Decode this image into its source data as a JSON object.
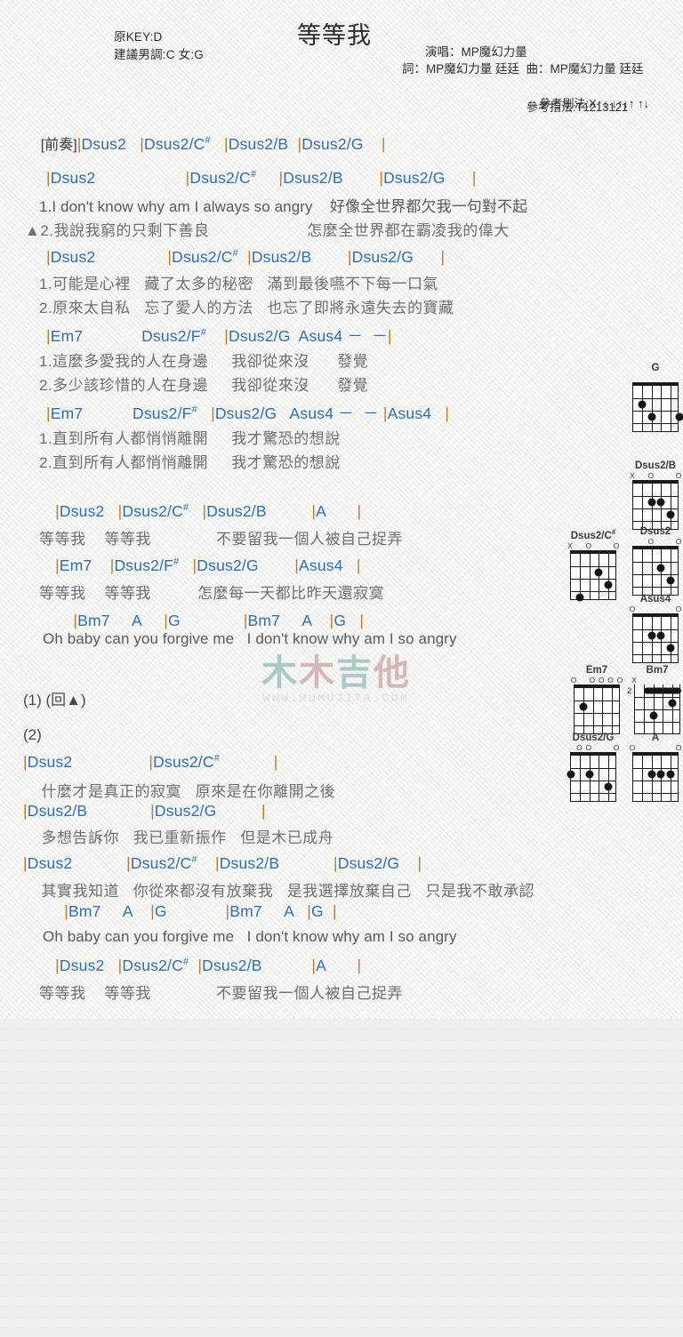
{
  "header": {
    "title": "等等我",
    "orig_key": "原KEY:D",
    "suggested_key": "建議男調:C 女:G",
    "singer": "演唱：MP魔幻力量",
    "writers": "詞：MP魔幻力量 廷廷  曲：MP魔幻力量 廷廷",
    "strum_label": "參考刷法:X",
    "strum_pattern": "↑↓ ↓↑↓↑ ↑↓",
    "fingering": "參考指法:T1213121"
  },
  "watermark": {
    "logo_chars": [
      "木",
      "木",
      "吉",
      "他"
    ],
    "url": "WWW.MUMUJITA.COM"
  },
  "sections": [
    {
      "name": "intro",
      "label": "[前奏]",
      "chords": "|Dsus2   |Dsus2/C#   |Dsus2/B  |Dsus2/G    |"
    }
  ],
  "lines": [
    {
      "type": "chord",
      "id": "c1",
      "text": "|Dsus2                    |Dsus2/C#     |Dsus2/B        |Dsus2/G      |"
    },
    {
      "type": "lyric",
      "id": "l1a",
      "text": "1.I don't know why am I always so angry    好像全世界都欠我一句對不起"
    },
    {
      "type": "lyric",
      "id": "l1b",
      "text": "▲2.我說我窮的只剩下善良                     怎麼全世界都在霸凌我的偉大"
    },
    {
      "type": "chord",
      "id": "c2",
      "text": "|Dsus2                |Dsus2/C#  |Dsus2/B        |Dsus2/G      |"
    },
    {
      "type": "lyric",
      "id": "l2a",
      "text": "1.可能是心裡   藏了太多的秘密   滿到最後嚥不下每一口氣"
    },
    {
      "type": "lyric",
      "id": "l2b",
      "text": "2.原來太自私   忘了愛人的方法   也忘了即將永遠失去的寶藏"
    },
    {
      "type": "chord",
      "id": "c3",
      "text": "|Em7             Dsus2/F#    |Dsus2/G  Asus4 －  －|"
    },
    {
      "type": "lyric",
      "id": "l3a",
      "text": "1.這麼多愛我的人在身邊     我卻從來沒      發覺"
    },
    {
      "type": "lyric",
      "id": "l3b",
      "text": "2.多少該珍惜的人在身邊     我卻從來沒      發覺"
    },
    {
      "type": "chord",
      "id": "c4",
      "text": "|Em7           Dsus2/F#   |Dsus2/G   Asus4 －  － |Asus4   |"
    },
    {
      "type": "lyric",
      "id": "l4a",
      "text": "1.直到所有人都悄悄離開     我才驚恐的想說"
    },
    {
      "type": "lyric",
      "id": "l4b",
      "text": "2.直到所有人都悄悄離開     我才驚恐的想說"
    },
    {
      "type": "chord",
      "id": "c5",
      "text": "  |Dsus2   |Dsus2/C#   |Dsus2/B          |A       |"
    },
    {
      "type": "lyric",
      "id": "l5",
      "text": "等等我    等等我              不要留我一個人被自己捉弄"
    },
    {
      "type": "chord",
      "id": "c6",
      "text": "  |Em7    |Dsus2/F#   |Dsus2/G        |Asus4   |"
    },
    {
      "type": "lyric",
      "id": "l6",
      "text": "等等我    等等我          怎麼每一天都比昨天還寂寞"
    },
    {
      "type": "chord",
      "id": "c7",
      "text": "      |Bm7     A     |G              |Bm7     A    |G   |"
    },
    {
      "type": "lyric_en",
      "id": "l7",
      "text": "Oh baby can you forgive me   I don't know why am I so angry"
    },
    {
      "type": "section",
      "id": "s1",
      "text": "(1) (回▲)"
    },
    {
      "type": "section",
      "id": "s2",
      "text": "(2)"
    },
    {
      "type": "chord",
      "id": "c8",
      "text": "|Dsus2                 |Dsus2/C#            |"
    },
    {
      "type": "lyric",
      "id": "l8",
      "text": "  什麼才是真正的寂寞   原來是在你離開之後"
    },
    {
      "type": "chord",
      "id": "c9",
      "text": "|Dsus2/B              |Dsus2/G          |"
    },
    {
      "type": "lyric",
      "id": "l9",
      "text": "  多想告訴你   我已重新振作   但是木已成舟"
    },
    {
      "type": "chord",
      "id": "c10",
      "text": "|Dsus2            |Dsus2/C#    |Dsus2/B            |Dsus2/G    |"
    },
    {
      "type": "lyric",
      "id": "l10",
      "text": "  其實我知道   你從來都沒有放棄我   是我選擇放棄自己   只是我不敢承認"
    },
    {
      "type": "chord",
      "id": "c11",
      "text": "    |Bm7     A    |G             |Bm7     A   |G  |"
    },
    {
      "type": "lyric_en",
      "id": "l11",
      "text": "Oh baby can you forgive me   I don't know why am I so angry"
    },
    {
      "type": "chord",
      "id": "c12",
      "text": "  |Dsus2   |Dsus2/C#  |Dsus2/B           |A       |"
    },
    {
      "type": "lyric",
      "id": "l12",
      "text": "等等我    等等我              不要留我一個人被自己捉弄"
    }
  ],
  "chord_diagrams": [
    {
      "name": "G",
      "sup": "",
      "markers": [
        "",
        "",
        "",
        "",
        "",
        ""
      ],
      "nut": true,
      "dots": [
        [
          5,
          2
        ],
        [
          4,
          3
        ],
        [
          1,
          3
        ]
      ],
      "barre": null,
      "fret": ""
    },
    {
      "name": "Dsus2/B",
      "sup": "",
      "markers": [
        "X",
        "",
        "O",
        "",
        "",
        "O"
      ],
      "nut": true,
      "dots": [
        [
          4,
          2
        ],
        [
          3,
          2
        ],
        [
          2,
          3
        ]
      ],
      "barre": null,
      "fret": ""
    },
    {
      "name": "Dsus2/C",
      "sup": "#",
      "markers": [
        "X",
        "",
        "O",
        "",
        "",
        "O"
      ],
      "nut": true,
      "dots": [
        [
          3,
          2
        ],
        [
          2,
          3
        ],
        [
          5,
          4
        ]
      ],
      "barre": null,
      "fret": ""
    },
    {
      "name": "Dsus2",
      "sup": "",
      "markers": [
        "",
        "",
        "O",
        "",
        "",
        "O"
      ],
      "nut": true,
      "dots": [
        [
          3,
          2
        ],
        [
          2,
          3
        ]
      ],
      "barre": null,
      "fret": ""
    },
    {
      "name": "Asus4",
      "sup": "",
      "markers": [
        "O",
        "",
        "",
        "",
        "",
        "O"
      ],
      "nut": true,
      "dots": [
        [
          4,
          2
        ],
        [
          3,
          2
        ],
        [
          2,
          3
        ]
      ],
      "barre": null,
      "fret": ""
    },
    {
      "name": "Em7",
      "sup": "",
      "markers": [
        "O",
        "",
        "O",
        "O",
        "O",
        "O"
      ],
      "nut": true,
      "dots": [
        [
          5,
          2
        ]
      ],
      "barre": null,
      "fret": ""
    },
    {
      "name": "Bm7",
      "sup": "",
      "markers": [
        "X",
        "",
        "",
        "",
        "",
        ""
      ],
      "nut": false,
      "dots": [
        [
          4,
          3
        ],
        [
          2,
          2
        ]
      ],
      "barre": {
        "fret": 1,
        "from": 5,
        "to": 1
      },
      "fret": "2"
    },
    {
      "name": "Dsus2/G",
      "sup": "",
      "markers": [
        "",
        "O",
        "O",
        "",
        "",
        "O"
      ],
      "nut": true,
      "dots": [
        [
          6,
          2
        ],
        [
          4,
          2
        ],
        [
          2,
          3
        ]
      ],
      "barre": null,
      "fret": ""
    },
    {
      "name": "A",
      "sup": "",
      "markers": [
        "O",
        "",
        "",
        "",
        "",
        "O"
      ],
      "nut": true,
      "dots": [
        [
          4,
          2
        ],
        [
          3,
          2
        ],
        [
          2,
          2
        ]
      ],
      "barre": null,
      "fret": ""
    }
  ]
}
